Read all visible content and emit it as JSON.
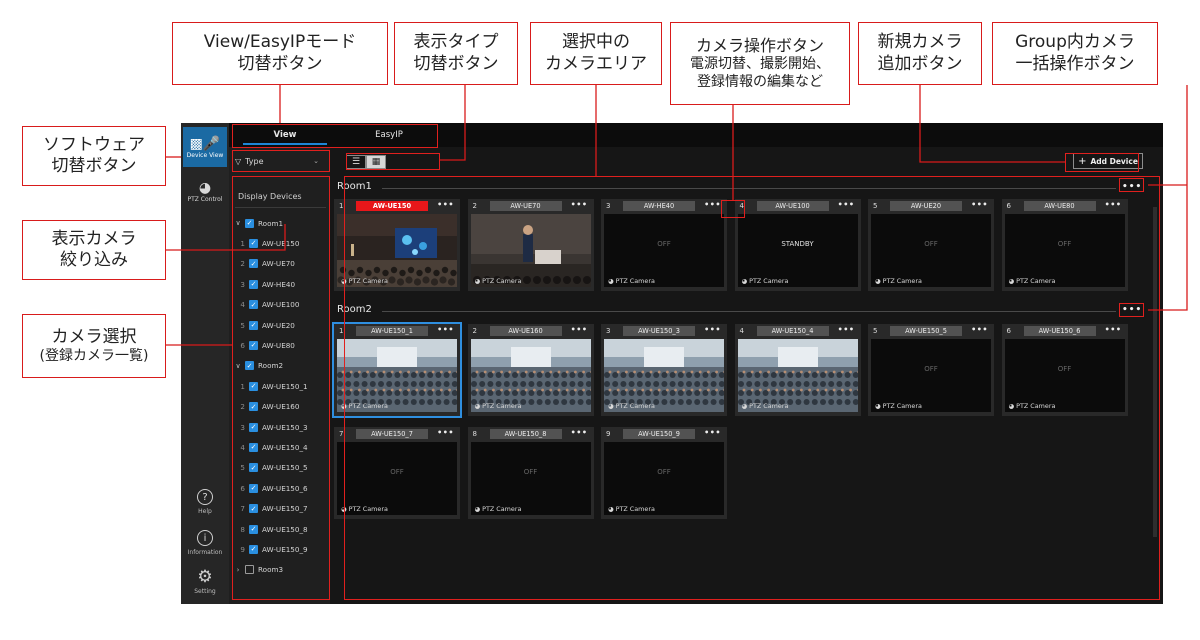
{
  "callouts": {
    "mode": [
      "View/EasyIPモード",
      "切替ボタン"
    ],
    "display_type": [
      "表示タイプ",
      "切替ボタン"
    ],
    "selected_area": [
      "選択中の",
      "カメラエリア"
    ],
    "camera_ops": [
      "カメラ操作ボタン",
      "電源切替、撮影開始、",
      "登録情報の編集など"
    ],
    "add_camera": [
      "新規カメラ",
      "追加ボタン"
    ],
    "group_ops": [
      "Group内カメラ",
      "一括操作ボタン"
    ],
    "software": [
      "ソフトウェア",
      "切替ボタン"
    ],
    "filter": [
      "表示カメラ",
      "絞り込み"
    ],
    "camera_select": [
      "カメラ選択",
      "(登録カメラ一覧)"
    ]
  },
  "rail": {
    "device_view": "Device View",
    "ptz_control": "PTZ Control",
    "help": "Help",
    "information": "Information",
    "setting": "Setting"
  },
  "top_tabs": {
    "view": "View",
    "easyip": "EasyIP"
  },
  "sidebar": {
    "type_label": "Type",
    "display_devices": "Display Devices",
    "tree": [
      {
        "kind": "group",
        "label": "Room1",
        "checked": true,
        "expanded": true
      },
      {
        "kind": "cam",
        "num": "1",
        "label": "AW-UE150",
        "checked": true
      },
      {
        "kind": "cam",
        "num": "2",
        "label": "AW-UE70",
        "checked": true
      },
      {
        "kind": "cam",
        "num": "3",
        "label": "AW-HE40",
        "checked": true
      },
      {
        "kind": "cam",
        "num": "4",
        "label": "AW-UE100",
        "checked": true
      },
      {
        "kind": "cam",
        "num": "5",
        "label": "AW-UE20",
        "checked": true
      },
      {
        "kind": "cam",
        "num": "6",
        "label": "AW-UE80",
        "checked": true
      },
      {
        "kind": "group",
        "label": "Room2",
        "checked": true,
        "expanded": true
      },
      {
        "kind": "cam",
        "num": "1",
        "label": "AW-UE150_1",
        "checked": true
      },
      {
        "kind": "cam",
        "num": "2",
        "label": "AW-UE160",
        "checked": true
      },
      {
        "kind": "cam",
        "num": "3",
        "label": "AW-UE150_3",
        "checked": true
      },
      {
        "kind": "cam",
        "num": "4",
        "label": "AW-UE150_4",
        "checked": true
      },
      {
        "kind": "cam",
        "num": "5",
        "label": "AW-UE150_5",
        "checked": true
      },
      {
        "kind": "cam",
        "num": "6",
        "label": "AW-UE150_6",
        "checked": true
      },
      {
        "kind": "cam",
        "num": "7",
        "label": "AW-UE150_7",
        "checked": true
      },
      {
        "kind": "cam",
        "num": "8",
        "label": "AW-UE150_8",
        "checked": true
      },
      {
        "kind": "cam",
        "num": "9",
        "label": "AW-UE150_9",
        "checked": true
      },
      {
        "kind": "group",
        "label": "Room3",
        "checked": false,
        "expanded": false
      }
    ]
  },
  "main": {
    "add_device": "Add Device",
    "groups": [
      {
        "name": "Room1",
        "cameras": [
          {
            "num": "1",
            "name": "AW-UE150",
            "state": "",
            "type": "PTZ Camera",
            "highlight": "red",
            "thumb": "stage"
          },
          {
            "num": "2",
            "name": "AW-UE70",
            "state": "",
            "type": "PTZ Camera",
            "thumb": "speaker"
          },
          {
            "num": "3",
            "name": "AW-HE40",
            "state": "OFF",
            "type": "PTZ Camera"
          },
          {
            "num": "4",
            "name": "AW-UE100",
            "state": "STANDBY",
            "type": "PTZ Camera"
          },
          {
            "num": "5",
            "name": "AW-UE20",
            "state": "OFF",
            "type": "PTZ Camera"
          },
          {
            "num": "6",
            "name": "AW-UE80",
            "state": "OFF",
            "type": "PTZ Camera"
          }
        ]
      },
      {
        "name": "Room2",
        "cameras": [
          {
            "num": "1",
            "name": "AW-UE150_1",
            "state": "",
            "type": "PTZ Camera",
            "selected": true,
            "thumb": "hall"
          },
          {
            "num": "2",
            "name": "AW-UE160",
            "state": "",
            "type": "PTZ Camera",
            "thumb": "hall"
          },
          {
            "num": "3",
            "name": "AW-UE150_3",
            "state": "",
            "type": "PTZ Camera",
            "thumb": "hall"
          },
          {
            "num": "4",
            "name": "AW-UE150_4",
            "state": "",
            "type": "PTZ Camera",
            "thumb": "hall"
          },
          {
            "num": "5",
            "name": "AW-UE150_5",
            "state": "OFF",
            "type": "PTZ Camera"
          },
          {
            "num": "6",
            "name": "AW-UE150_6",
            "state": "OFF",
            "type": "PTZ Camera"
          },
          {
            "num": "7",
            "name": "AW-UE150_7",
            "state": "OFF",
            "type": "PTZ Camera"
          },
          {
            "num": "8",
            "name": "AW-UE150_8",
            "state": "OFF",
            "type": "PTZ Camera"
          },
          {
            "num": "9",
            "name": "AW-UE150_9",
            "state": "OFF",
            "type": "PTZ Camera"
          }
        ]
      }
    ]
  },
  "colors": {
    "accent_blue": "#1b6aa3",
    "check_blue": "#2a8fe0",
    "callout_red": "#d81b1b",
    "name_red": "#e8171a",
    "app_bg": "#161616"
  },
  "icons": {
    "device_view": "camera-mic-icon",
    "ptz_control": "camera-dome-icon",
    "help": "question-circle-icon",
    "information": "info-circle-icon",
    "setting": "gear-icon",
    "type_filter": "funnel-icon",
    "list_view": "list-icon",
    "grid_view": "grid-icon",
    "add": "plus-icon",
    "more": "ellipsis-icon"
  }
}
